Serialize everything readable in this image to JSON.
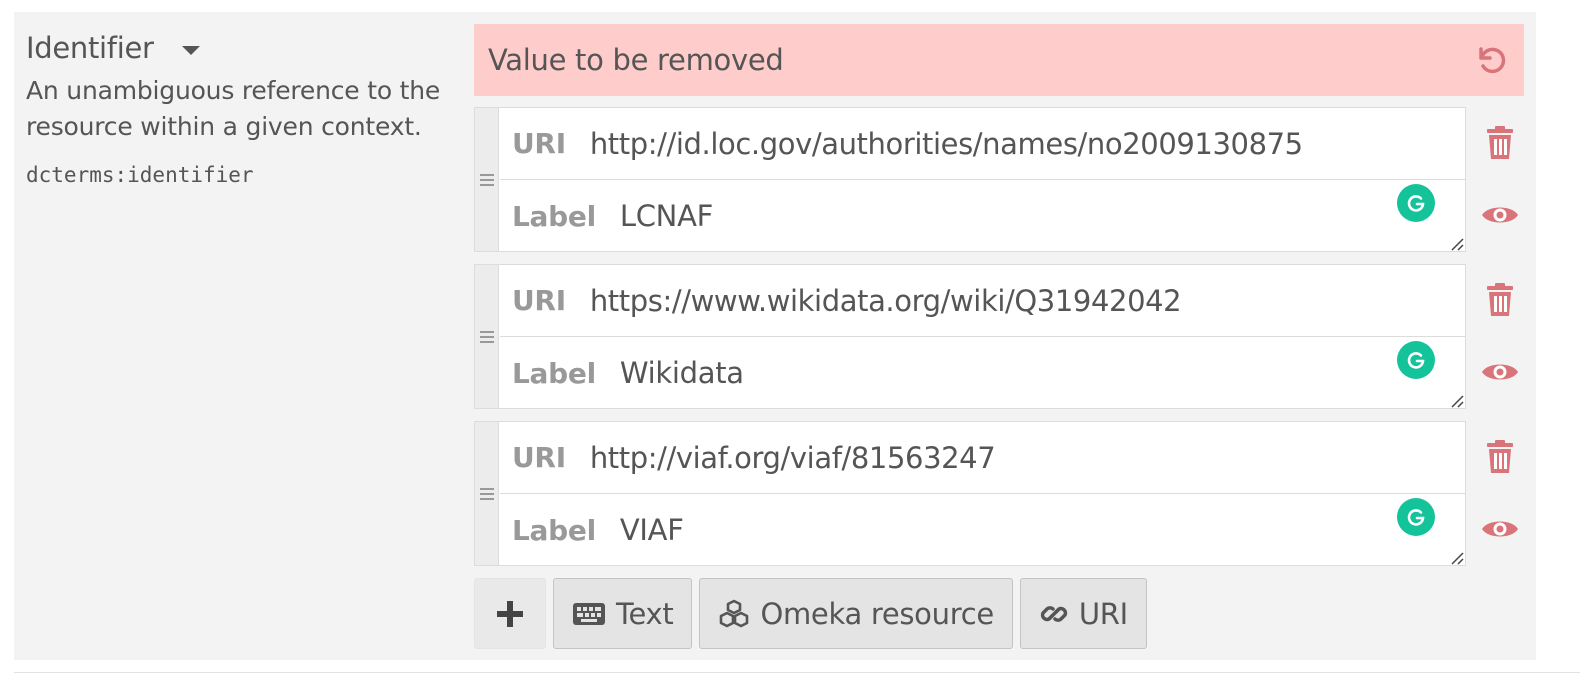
{
  "field": {
    "title": "Identifier",
    "description_line1": "An unambiguous reference to the",
    "description_line2": "resource within a given context.",
    "term": "dcterms:identifier"
  },
  "removed": {
    "text": "Value to be removed",
    "icon": "undo-icon"
  },
  "values": [
    {
      "uri_label": "URI",
      "uri": "http://id.loc.gov/authorities/names/no2009130875",
      "label_label": "Label",
      "label": "LCNAF"
    },
    {
      "uri_label": "URI",
      "uri": "https://www.wikidata.org/wiki/Q31942042",
      "label_label": "Label",
      "label": "Wikidata"
    },
    {
      "uri_label": "URI",
      "uri": "http://viaf.org/viaf/81563247",
      "label_label": "Label",
      "label": "VIAF"
    }
  ],
  "toolbar": {
    "add_label": "+",
    "text_label": "Text",
    "omeka_label": "Omeka resource",
    "uri_label": "URI"
  },
  "colors": {
    "removed_bg": "#fecccb",
    "danger": "#d9747a",
    "grammarly": "#15c39a",
    "panel": "#f3f3f3"
  }
}
